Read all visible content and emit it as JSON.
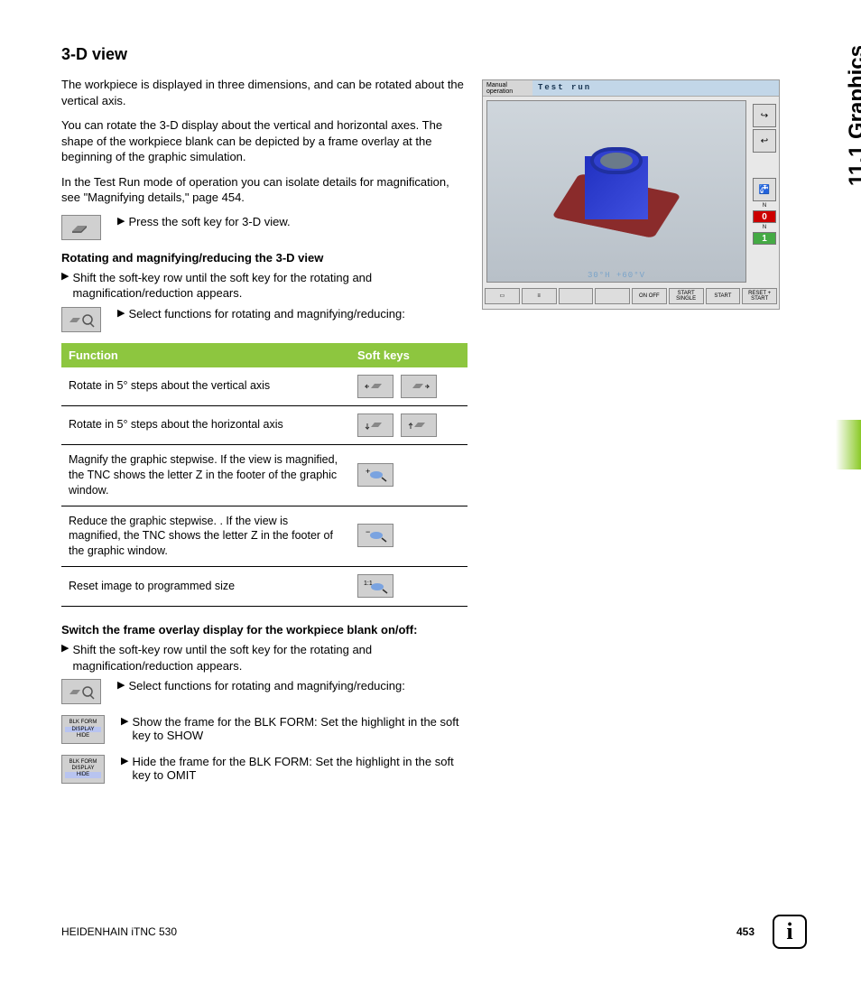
{
  "side_label": "11.1 Graphics",
  "section_title": "3-D view",
  "para1": "The workpiece is displayed in three dimensions, and can be rotated about the vertical axis.",
  "para2": "You can rotate the 3-D display about the vertical and horizontal axes. The shape of the workpiece blank can be depicted by a frame overlay at the beginning of the graphic simulation.",
  "para3": "In the Test Run mode of operation you can isolate details for magnification, see \"Magnifying details,\" page 454.",
  "press_softkey": "Press the soft key for 3-D view.",
  "rotating_heading": "Rotating and magnifying/reducing the 3-D view",
  "shift_row": "Shift the soft-key row until the soft key for the rotating and magnification/reduction appears.",
  "select_functions": "Select functions for rotating and magnifying/reducing:",
  "table": {
    "head_function": "Function",
    "head_softkeys": "Soft keys",
    "rows": [
      {
        "func": "Rotate in 5° steps about the vertical axis"
      },
      {
        "func": "Rotate in 5° steps about the horizontal axis"
      },
      {
        "func": "Magnify the graphic stepwise. If the view is magnified, the TNC shows the letter Z in the footer of the graphic window."
      },
      {
        "func": "Reduce the graphic stepwise. . If the view is magnified, the TNC shows the letter Z in the footer of the graphic window."
      },
      {
        "func": "Reset image to programmed size"
      }
    ]
  },
  "switch_heading": "Switch the frame overlay display for the workpiece blank on/off:",
  "show_text": "Show the frame for the BLK FORM: Set the highlight in the soft key to SHOW",
  "hide_text": "Hide the frame for the BLK FORM: Set the highlight in the soft key to OMIT",
  "blk_label1": "BLK FORM",
  "blk_label2": "DISPLAY",
  "blk_label3": "HIDE",
  "screenshot": {
    "mode": "Manual operation",
    "title": "Test run",
    "status": "30°H +60°V",
    "btn_start": "START",
    "btn_start_single": "START SINGLE",
    "btn_reset": "RESET + START",
    "on_off": "ON OFF",
    "n_label": "N",
    "zero": "0",
    "one": "1"
  },
  "footer": {
    "product": "HEIDENHAIN iTNC 530",
    "page": "453"
  }
}
